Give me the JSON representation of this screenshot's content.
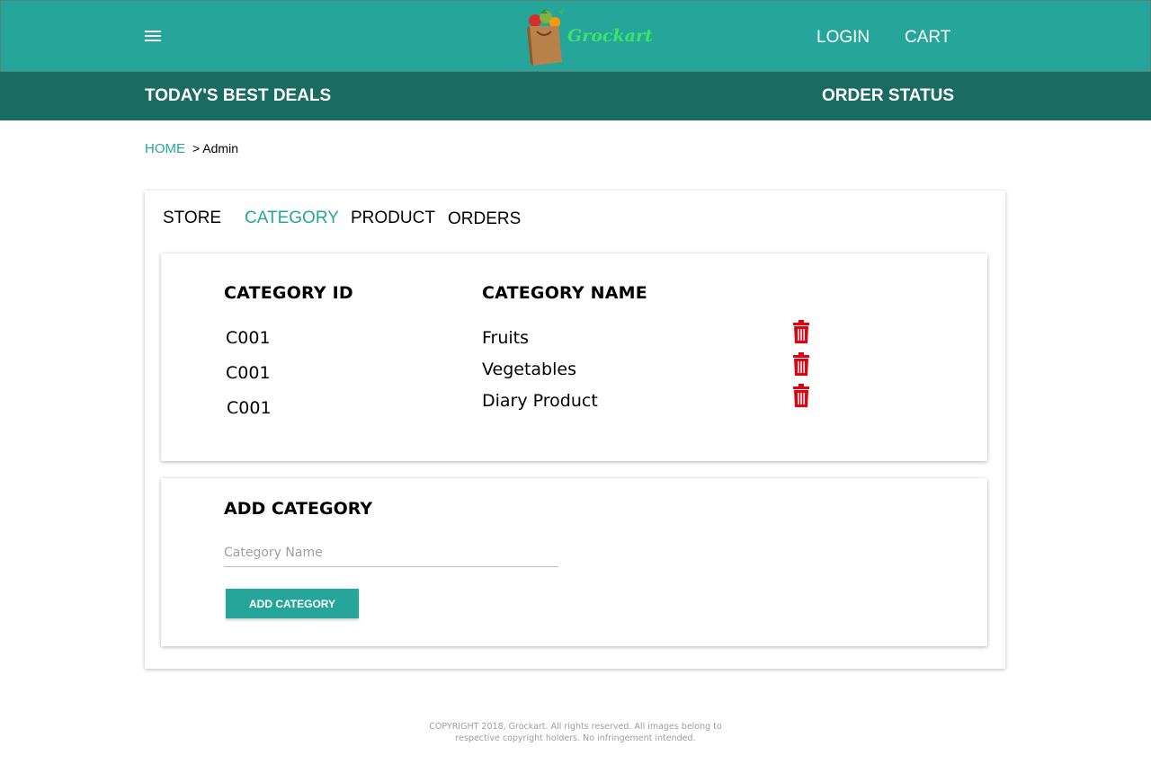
{
  "header": {
    "menu_icon": "hamburger-menu-icon",
    "logo_text": "Grockart",
    "login_label": "LOGIN",
    "cart_label": "CART",
    "accent_color": "#26a69a"
  },
  "subnav": {
    "deals_label": "TODAY'S BEST DEALS",
    "order_status_label": "ORDER STATUS",
    "background_color": "#1a6b62"
  },
  "breadcrumb": {
    "home_label": "HOME",
    "current": "> Admin"
  },
  "tabs": [
    {
      "label": "STORE",
      "active": false
    },
    {
      "label": "CATEGORY",
      "active": true
    },
    {
      "label": "PRODUCT",
      "active": false
    },
    {
      "label": "ORDERS",
      "active": false
    }
  ],
  "category_table": {
    "columns": [
      "CATEGORY ID",
      "CATEGORY NAME"
    ],
    "rows": [
      {
        "id": "C001",
        "name": "Fruits",
        "action_icon": "trash-icon"
      },
      {
        "id": "C001",
        "name": "Vegetables",
        "action_icon": "trash-icon"
      },
      {
        "id": "C001",
        "name": "Diary Product",
        "action_icon": "trash-icon"
      }
    ],
    "delete_icon_color": "#e3000f"
  },
  "add_category": {
    "title": "ADD CATEGORY",
    "input_placeholder": "Category Name",
    "input_value": "",
    "button_label": "ADD CATEGORY"
  },
  "footer": {
    "line1": "COPYRIGHT 2018, Grockart. All rights reserved. All images belong to",
    "line2": "respective copyright holders. No infringement intended."
  }
}
